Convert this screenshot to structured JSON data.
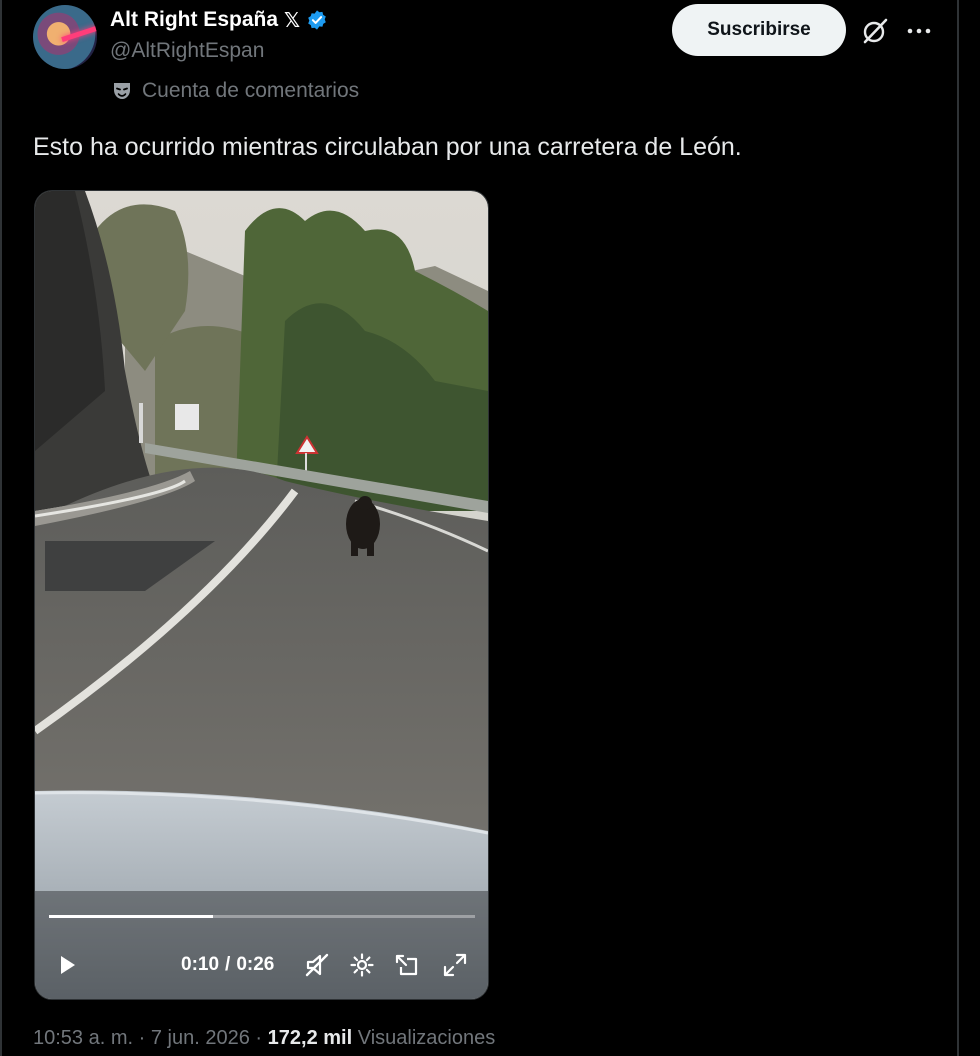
{
  "account": {
    "display_name": "Alt Right España",
    "badge_glyph": "𝕏",
    "handle": "@AltRightEspan",
    "label": "Cuenta de comentarios",
    "avatar_icon": "avatar-laser-eyes",
    "verified_color": "#1d9bf0"
  },
  "header": {
    "subscribe_label": "Suscribirse",
    "grok_icon": "grok-icon",
    "more_icon": "more-icon"
  },
  "tweet": {
    "text": "Esto ha ocurrido mientras circulaban por una carretera de León."
  },
  "video": {
    "current_time": "0:10",
    "separator": "/",
    "duration": "0:26",
    "progress_fraction": 0.385,
    "muted": true
  },
  "meta": {
    "time": "10:53 a. m.",
    "dot1": "·",
    "date": "7 jun. 2026",
    "dot2": "·",
    "views": "172,2 mil",
    "views_label": "Visualizaciones"
  },
  "colors": {
    "background": "#000000",
    "text_primary": "#e7e9ea",
    "text_secondary": "#71767b",
    "button_bg": "#eff3f4",
    "accent": "#1d9bf0"
  }
}
